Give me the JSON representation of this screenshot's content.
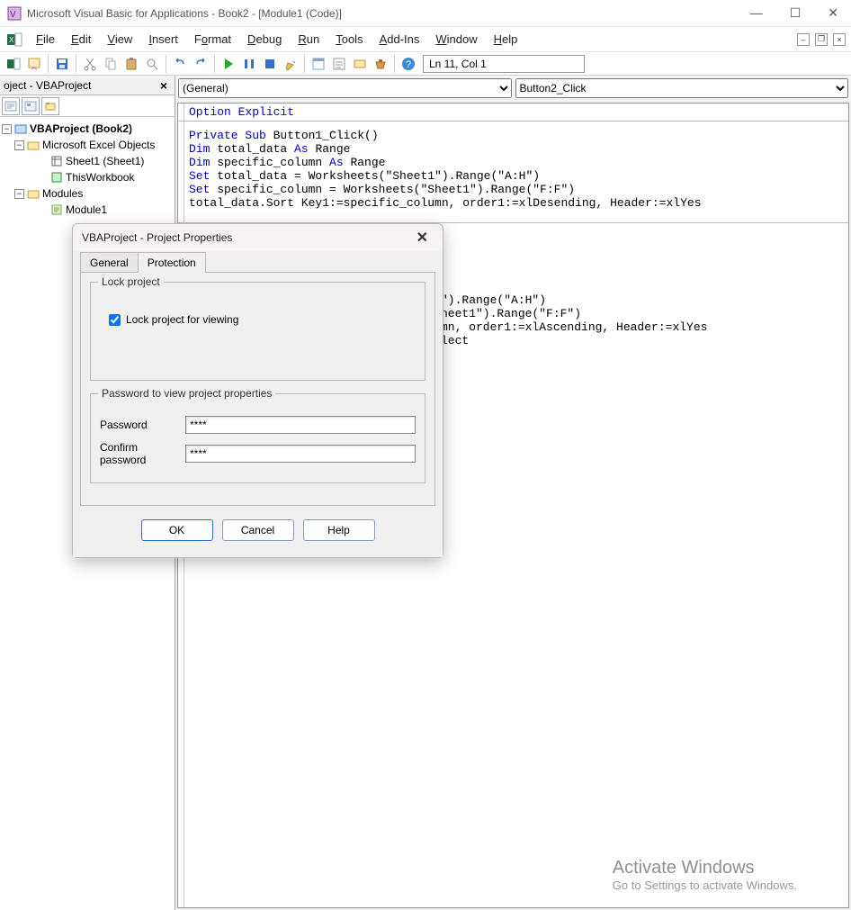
{
  "window": {
    "title": "Microsoft Visual Basic for Applications - Book2 - [Module1 (Code)]"
  },
  "menu": {
    "file": "File",
    "edit": "Edit",
    "view": "View",
    "insert": "Insert",
    "format": "Format",
    "debug": "Debug",
    "run": "Run",
    "tools": "Tools",
    "addins": "Add-Ins",
    "window": "Window",
    "help": "Help"
  },
  "toolbar": {
    "position": "Ln 11, Col 1"
  },
  "project_panel": {
    "title": "oject - VBAProject",
    "root": "VBAProject (Book2)",
    "exo": "Microsoft Excel Objects",
    "sheet1": "Sheet1 (Sheet1)",
    "thiswb": "ThisWorkbook",
    "modules": "Modules",
    "module1": "Module1"
  },
  "code": {
    "dd1": "(General)",
    "dd2": "Button2_Click",
    "lines": {
      "l1a": "Option Explicit",
      "l2a": "Private Sub",
      "l2b": " Button1_Click()",
      "l3a": "Dim",
      "l3b": " total_data ",
      "l3c": "As",
      "l3d": " Range",
      "l4a": "Dim",
      "l4b": " specific_column ",
      "l4c": "As",
      "l4d": " Range",
      "l5a": "Set",
      "l5b": " total_data = Worksheets(\"Sheet1\").Range(\"A:H\")",
      "l6a": "Set",
      "l6b": " specific_column = Worksheets(\"Sheet1\").Range(\"F:F\")",
      "l7": "total_data.Sort Key1:=specific_column, order1:=xlDesending, Header:=xlYes",
      "p1": "\").Range(\"A:H\")",
      "p2": "heet1\").Range(\"F:F\")",
      "p3": "mn, order1:=xlAscending, Header:=xlYes",
      "p4": "lect"
    }
  },
  "dialog": {
    "title": "VBAProject - Project Properties",
    "tabs": {
      "general": "General",
      "protection": "Protection"
    },
    "lock_legend": "Lock project",
    "lock_checkbox": "Lock project for viewing",
    "pw_legend": "Password to view project properties",
    "pw_label": "Password",
    "cpw_label": "Confirm password",
    "pw_value": "****",
    "cpw_value": "****",
    "ok": "OK",
    "cancel": "Cancel",
    "help": "Help"
  },
  "watermark": {
    "l1": "Activate Windows",
    "l2": "Go to Settings to activate Windows."
  }
}
